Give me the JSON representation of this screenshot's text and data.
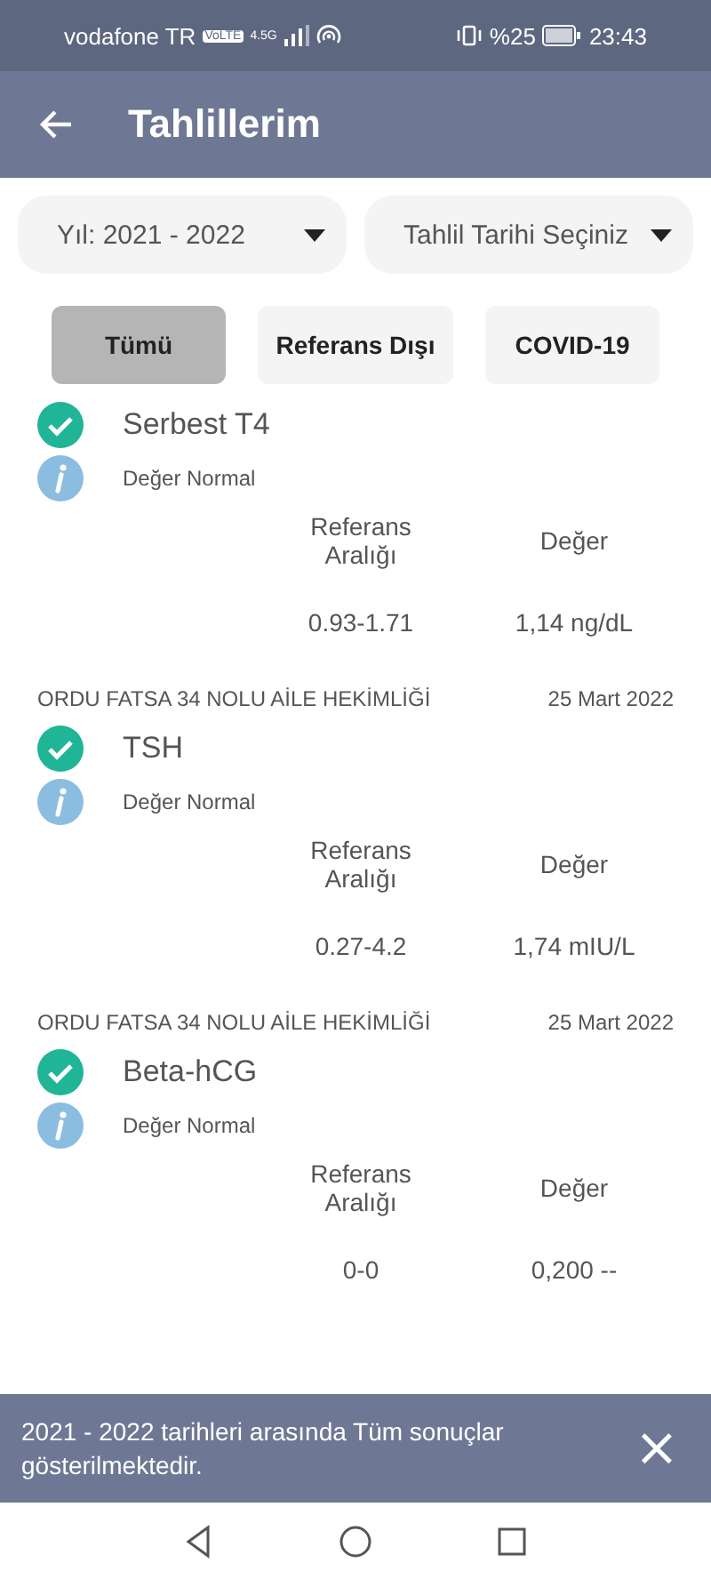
{
  "status_bar": {
    "carrier": "vodafone TR",
    "volte": "VoLTE",
    "network": "4.5G",
    "battery_percent": "%25",
    "time": "23:43"
  },
  "app_bar": {
    "title": "Tahlillerim"
  },
  "filters": [
    {
      "value": "Yıl: 2021 - 2022"
    },
    {
      "value": "Tahlil Tarihi Seçiniz"
    }
  ],
  "chips": [
    {
      "label": "Tümü",
      "selected": true
    },
    {
      "label": "Referans Dışı",
      "selected": false
    },
    {
      "label": "COVID-19",
      "selected": false
    }
  ],
  "results": [
    {
      "name": "Serbest T4",
      "normal": true,
      "status": "Değer Normal",
      "range_heading": "Referans Aralığı",
      "value_heading": "Değer",
      "range": "0.93-1.71",
      "value": "1,14 ng/dL"
    },
    {
      "lab": "ORDU FATSA 34 NOLU AİLE HEKİMLİĞİ",
      "date": "25 Mart 2022",
      "name": "TSH",
      "normal": true,
      "status": "Değer Normal",
      "range_heading": "Referans Aralığı",
      "value_heading": "Değer",
      "range": "0.27-4.2",
      "value": "1,74 mIU/L"
    },
    {
      "lab": "ORDU FATSA 34 NOLU AİLE HEKİMLİĞİ",
      "date": "25 Mart 2022",
      "name": "Beta-hCG",
      "normal": true,
      "status": "Değer Normal",
      "range_heading": "Referans Aralığı",
      "value_heading": "Değer",
      "range": "0-0",
      "value": "0,200 --"
    }
  ],
  "snackbar": {
    "message": "2021 - 2022 tarihleri arasında Tüm sonuçlar gösterilmektedir.",
    "close": "×"
  }
}
